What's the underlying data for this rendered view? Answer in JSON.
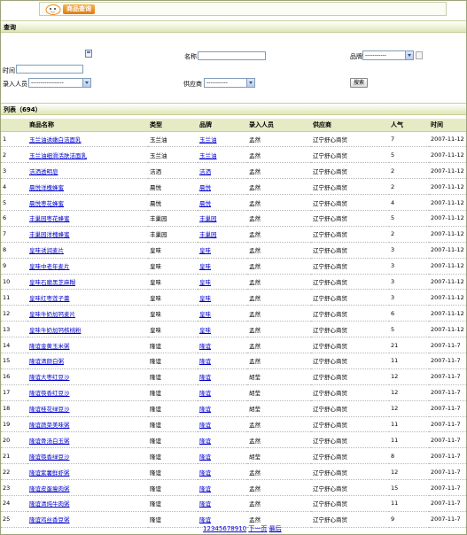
{
  "header": {
    "title": "商品查询"
  },
  "search_section": {
    "label": "查询",
    "name_label": "名称:",
    "brand_label": "品牌",
    "brand_value": "-----------",
    "time_label": "时间",
    "recorder_label": "录入人员",
    "recorder_value": "-----------------",
    "supplier_label": "供应商",
    "supplier_value": "-----------",
    "search_button": "搜索"
  },
  "list_section": {
    "label": "列表（694）"
  },
  "table": {
    "columns": [
      "",
      "商品名称",
      "类型",
      "品牌",
      "录入人员",
      "供应商",
      "人气",
      "时间"
    ],
    "rows": [
      [
        "1",
        "玉兰油诱嫩白洁面乳",
        "玉兰油",
        "玉兰油",
        "孟然",
        "辽宁舒心商贸",
        "7",
        "2007-11-12"
      ],
      [
        "2",
        "玉兰油细滑活肤洁面乳",
        "玉兰油",
        "玉兰油",
        "孟然",
        "辽宁舒心商贸",
        "5",
        "2007-11-12"
      ],
      [
        "3",
        "洁洒透明皂",
        "洁洒",
        "洁洒",
        "孟然",
        "辽宁舒心商贸",
        "2",
        "2007-11-12"
      ],
      [
        "4",
        "晨悦洋槐蜂蜜",
        "晨悦",
        "晨悦",
        "孟然",
        "辽宁舒心商贸",
        "2",
        "2007-11-12"
      ],
      [
        "5",
        "晨悦枣花蜂蜜",
        "晨悦",
        "晨悦",
        "孟然",
        "辽宁舒心商贸",
        "4",
        "2007-11-12"
      ],
      [
        "6",
        "丰巢园枣花蜂蜜",
        "丰巢园",
        "丰巢园",
        "孟然",
        "辽宁舒心商贸",
        "5",
        "2007-11-12"
      ],
      [
        "7",
        "丰巢园洋槐蜂蜜",
        "丰巢园",
        "丰巢园",
        "孟然",
        "辽宁舒心商贸",
        "2",
        "2007-11-12"
      ],
      [
        "8",
        "皇味诱润麦片",
        "皇味",
        "皇味",
        "孟然",
        "辽宁舒心商贸",
        "3",
        "2007-11-12"
      ],
      [
        "9",
        "皇味中老年麦片",
        "皇味",
        "皇味",
        "孟然",
        "辽宁舒心商贸",
        "3",
        "2007-11-12"
      ],
      [
        "10",
        "皇味石磨黑芝麻糊",
        "皇味",
        "皇味",
        "孟然",
        "辽宁舒心商贸",
        "3",
        "2007-11-12"
      ],
      [
        "11",
        "皇味红枣莲子羹",
        "皇味",
        "皇味",
        "孟然",
        "辽宁舒心商贸",
        "3",
        "2007-11-12"
      ],
      [
        "12",
        "皇味牛奶加钙麦片",
        "皇味",
        "皇味",
        "孟然",
        "辽宁舒心商贸",
        "6",
        "2007-11-12"
      ],
      [
        "13",
        "皇味牛奶加钙核桃粉",
        "皇味",
        "皇味",
        "孟然",
        "辽宁舒心商贸",
        "5",
        "2007-11-12"
      ],
      [
        "14",
        "隆谊金黄玉米粥",
        "隆谊",
        "隆谊",
        "孟然",
        "辽宁舒心商贸",
        "21",
        "2007-11-7"
      ],
      [
        "15",
        "隆谊清颜白粥",
        "隆谊",
        "隆谊",
        "孟然",
        "辽宁舒心商贸",
        "11",
        "2007-11-7"
      ],
      [
        "16",
        "隆谊大枣红豆沙",
        "隆谊",
        "隆谊",
        "胡莹",
        "辽宁舒心商贸",
        "12",
        "2007-11-7"
      ],
      [
        "17",
        "隆谊筷香红豆沙",
        "隆谊",
        "隆谊",
        "胡莹",
        "辽宁舒心商贸",
        "12",
        "2007-11-7"
      ],
      [
        "18",
        "隆谊桂花绿豆沙",
        "隆谊",
        "隆谊",
        "胡莹",
        "辽宁舒心商贸",
        "12",
        "2007-11-7"
      ],
      [
        "19",
        "隆谊蔬菜美味粥",
        "隆谊",
        "隆谊",
        "孟然",
        "辽宁舒心商贸",
        "11",
        "2007-11-7"
      ],
      [
        "20",
        "隆谊骨汤白玉粥",
        "隆谊",
        "隆谊",
        "孟然",
        "辽宁舒心商贸",
        "11",
        "2007-11-7"
      ],
      [
        "21",
        "隆谊筷香绿豆沙",
        "隆谊",
        "隆谊",
        "胡莹",
        "辽宁舒心商贸",
        "8",
        "2007-11-7"
      ],
      [
        "22",
        "隆谊紫薯鲜虾粥",
        "隆谊",
        "隆谊",
        "孟然",
        "辽宁舒心商贸",
        "12",
        "2007-11-7"
      ],
      [
        "23",
        "隆谊皮蛋瘦肉粥",
        "隆谊",
        "隆谊",
        "孟然",
        "辽宁舒心商贸",
        "15",
        "2007-11-7"
      ],
      [
        "24",
        "隆谊清炖牛肉粥",
        "隆谊",
        "隆谊",
        "孟然",
        "辽宁舒心商贸",
        "11",
        "2007-11-7"
      ],
      [
        "25",
        "隆谊鸡丝香豆粥",
        "隆谊",
        "隆谊",
        "孟然",
        "辽宁舒心商贸",
        "9",
        "2007-11-7"
      ]
    ]
  },
  "pager": {
    "pages": [
      "1",
      "2",
      "3",
      "4",
      "5",
      "6",
      "7",
      "8",
      "9",
      "10"
    ],
    "next_label": "下一页",
    "last_label": "最后"
  },
  "colors": {
    "bar": "#dfe6b4",
    "link": "#0000cc",
    "border": "#9aa47a"
  }
}
